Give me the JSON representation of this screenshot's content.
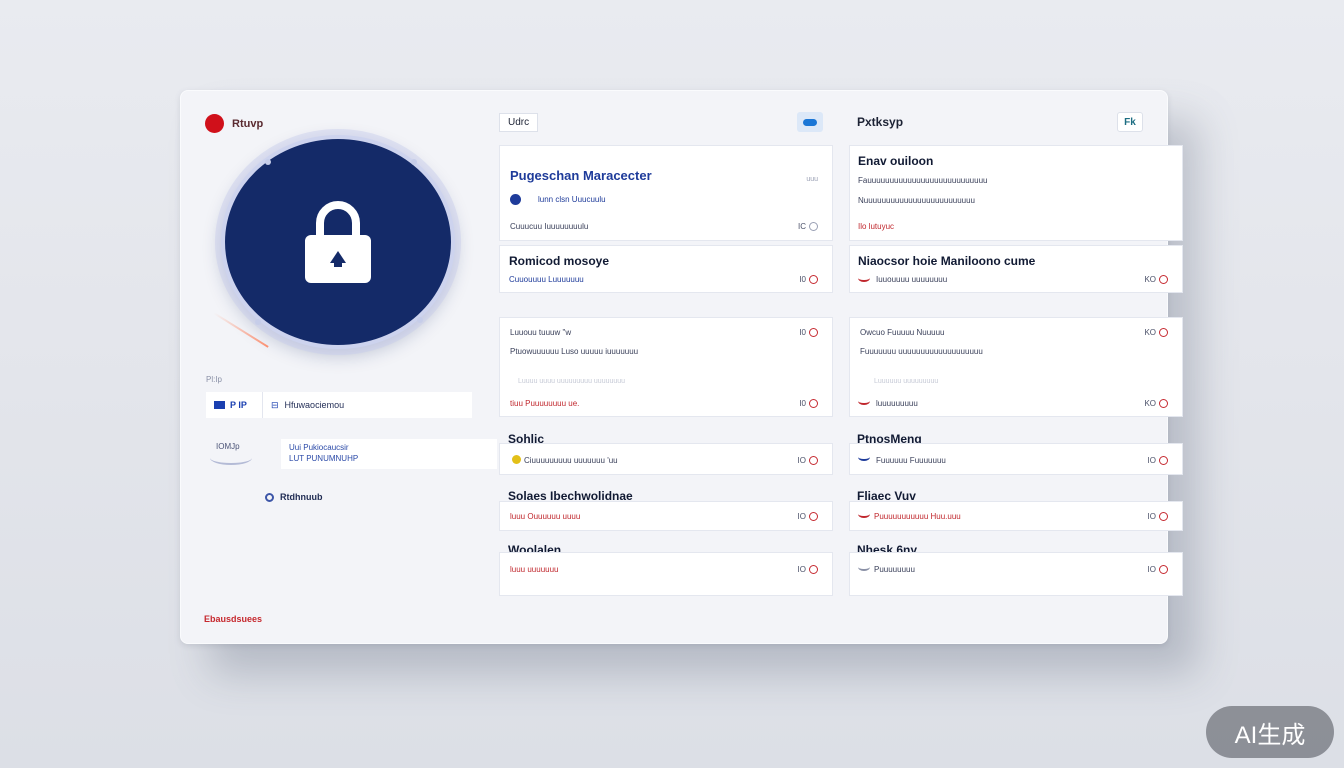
{
  "brand": {
    "name": "Rtuvp",
    "color": "#d0101a"
  },
  "left": {
    "section_label": "Pl:Ip",
    "row1": {
      "code": "P IP",
      "text": "Hfuwaociemou"
    },
    "row2": {
      "label": "IOMJp",
      "line1": "Uui Pukiocaucsir",
      "line2": "LUT PUNUMNUHP"
    },
    "radio_label": "Rtdhnuub",
    "footer_link": "Ebausdsuees"
  },
  "col1": {
    "tag": "Udrc",
    "cards": [
      {
        "title": "Pugeschan Maracecter",
        "meta": "uuu",
        "line1": "lunn clsn Uuucuulu",
        "line2": "Cuuucuu Iuuuuuuuulu",
        "kpi": "IC"
      },
      {
        "title": "Romicod mosoye",
        "sub": "Cuuouuuu Luuuuuuu",
        "kpi": "I0"
      },
      {
        "line1": "Luuouu tuuuw \"w",
        "line2": "Ptuowuuuuuu Luso uuuuu iuuuuuuu",
        "faint": "Luuuu uuuu uuuuuuuuu uuuuuuuu",
        "line3": "tiuu Puuuuuuuu ue.",
        "kpi1": "I0",
        "kpi2": "I0"
      }
    ],
    "groups": [
      {
        "title": "Sohlic",
        "sub": "Ciuuuuuuuuu uuuuuuu 'uu",
        "kpi": "IO"
      },
      {
        "title": "Solaes Ibechwolidnae",
        "sub": "luuu Ouuuuuu uuuu",
        "kpi": "IO"
      },
      {
        "title": "Woolalen",
        "sub": "luuu uuuuuuu",
        "kpi": "IO"
      }
    ]
  },
  "col2": {
    "title": "Pxtksyp",
    "btn": "Fk",
    "cards": [
      {
        "title": "Enav ouiloon",
        "line1": "Fauuuuuuuuuuuuuuuuuuuuuuuuuuu",
        "line2": "Nuuuuuuuuuuuuuuuuuuuuuuuuu",
        "line3": "Ilo lutuyuc",
        "kpi": ""
      },
      {
        "title": "Niaocsor hoie Maniloono cume",
        "sub": "Iuuouuuu uuuuuuuu",
        "kpi": "KO"
      },
      {
        "line1": "Owcuo Fuuuuu Nuuuuu",
        "line2": "Fuuuuuuu uuuuuuuuuuuuuuuuuuu",
        "faint": "Luuuuuu uuuuuuuuu",
        "line3": "luuuuuuuuu",
        "kpi1": "KO",
        "kpi2": "KO"
      }
    ],
    "groups": [
      {
        "title": "PtnosMeng",
        "sub": "Fuuuuuu Fuuuuuuu",
        "kpi": "IO"
      },
      {
        "title": "Fliaec Vuv",
        "sub": "Puuuuuuuuuuu Huu.uuu",
        "kpi": "IO"
      },
      {
        "title": "Nhesk 6ny",
        "sub": "Puuuuuuuu",
        "kpi": "IO"
      }
    ]
  },
  "watermark": "AI生成",
  "colors": {
    "accent": "#142a68",
    "danger": "#c0272d",
    "link": "#1e3b9a"
  }
}
